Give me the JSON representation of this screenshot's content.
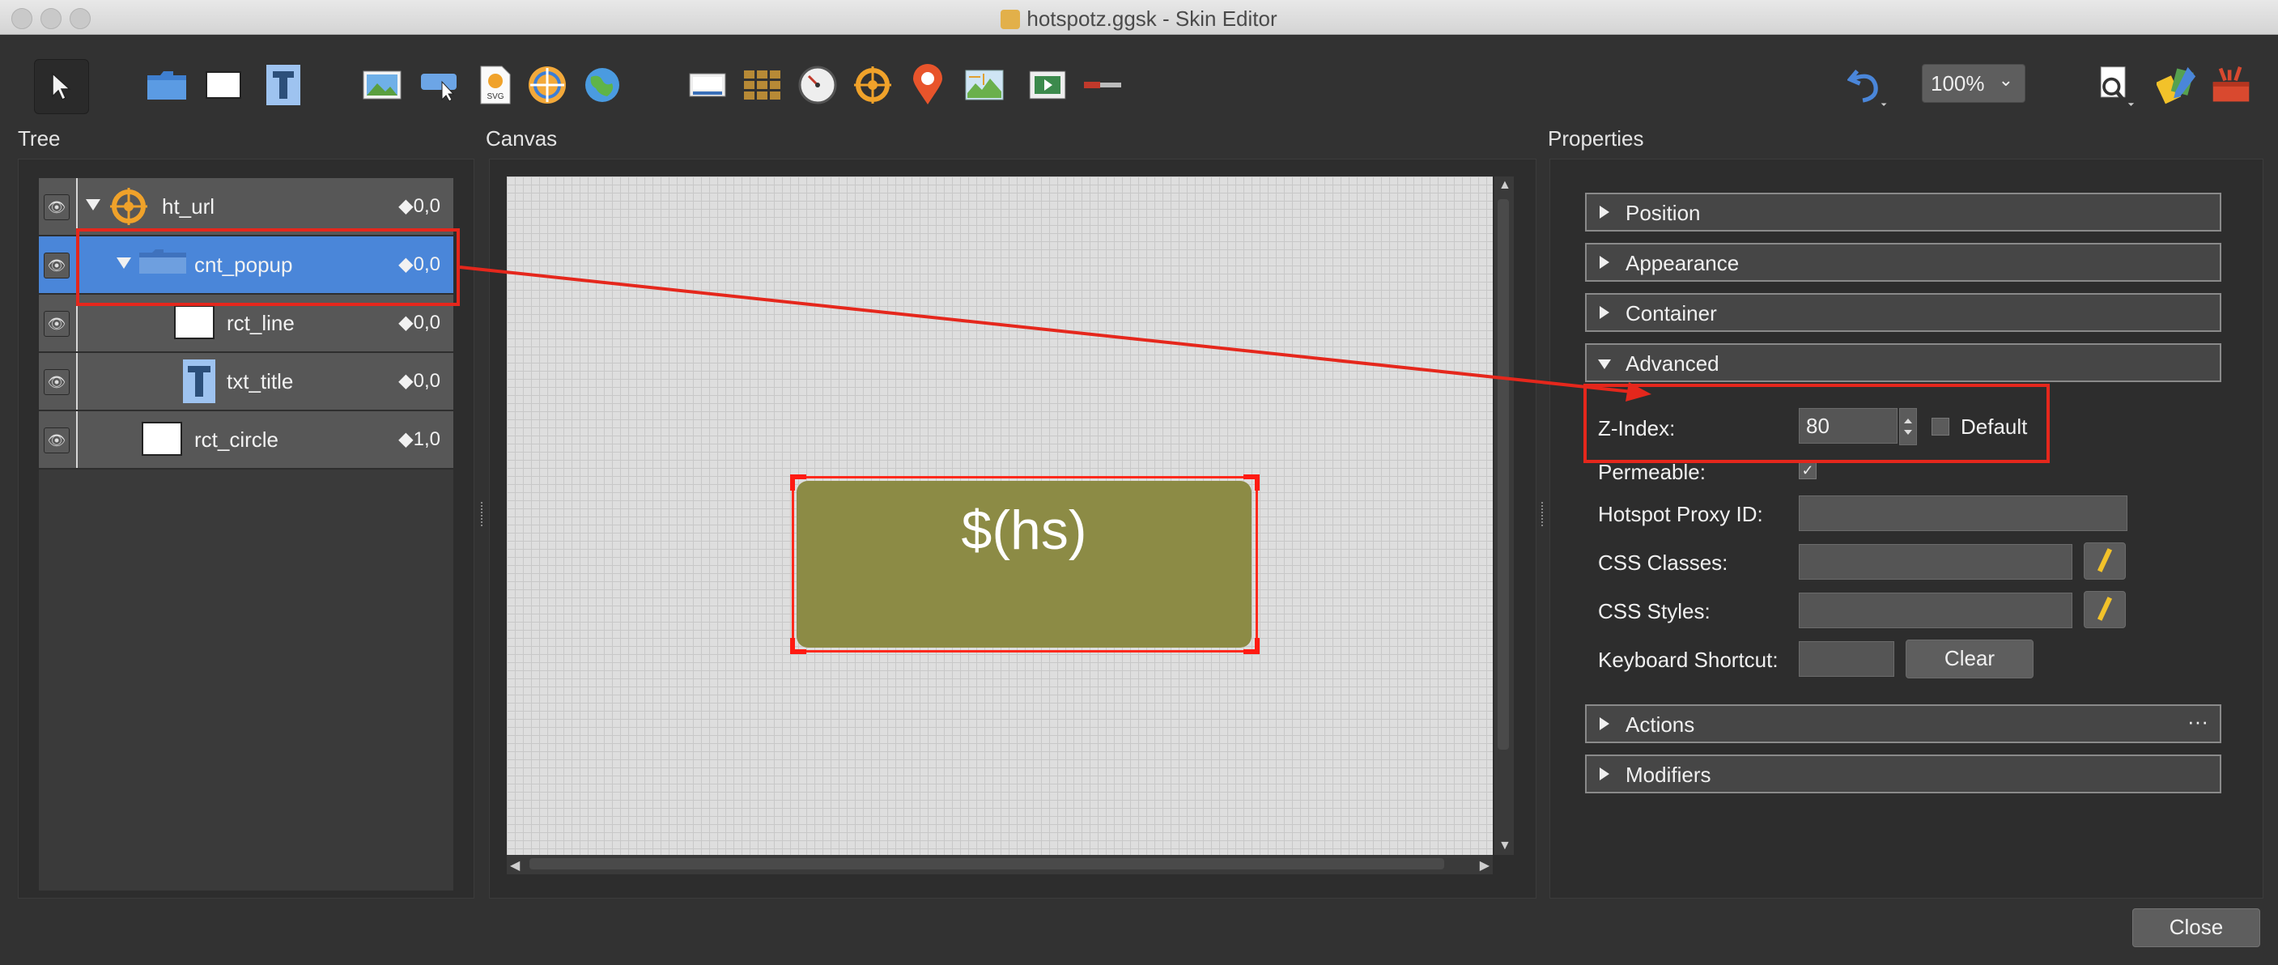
{
  "window": {
    "title": "hotspotz.ggsk - Skin Editor"
  },
  "toolbar": {
    "tools": [
      {
        "name": "select-tool",
        "icon": "arrow-cursor-icon"
      },
      {
        "name": "container-tool",
        "icon": "folder-icon"
      },
      {
        "name": "rectangle-tool",
        "icon": "rectangle-icon"
      },
      {
        "name": "text-tool",
        "icon": "text-icon"
      },
      {
        "name": "image-tool",
        "icon": "image-icon"
      },
      {
        "name": "button-tool",
        "icon": "button-icon"
      },
      {
        "name": "svg-tool",
        "icon": "svg-icon"
      },
      {
        "name": "hotspot-tool",
        "icon": "hotspot-icon"
      },
      {
        "name": "globe-tool",
        "icon": "globe-icon"
      },
      {
        "name": "screen-tool",
        "icon": "screen-icon"
      },
      {
        "name": "cloner-tool",
        "icon": "grid-icon"
      },
      {
        "name": "timer-tool",
        "icon": "timer-icon"
      },
      {
        "name": "hotspot-proxy-tool",
        "icon": "crosshair-icon"
      },
      {
        "name": "map-pin-tool",
        "icon": "map-pin-icon"
      },
      {
        "name": "map-tool",
        "icon": "map-icon"
      },
      {
        "name": "video-tool",
        "icon": "video-icon"
      },
      {
        "name": "scrollbar-tool",
        "icon": "scrollbar-icon"
      }
    ],
    "zoom": "100%",
    "zoom_caret": "⌄"
  },
  "panels": {
    "tree": "Tree",
    "canvas": "Canvas",
    "properties": "Properties"
  },
  "tree": {
    "rows": [
      {
        "label": "ht_url",
        "value": "◆0,0"
      },
      {
        "label": "cnt_popup",
        "value": "◆0,0"
      },
      {
        "label": "rct_line",
        "value": "◆0,0"
      },
      {
        "label": "txt_title",
        "value": "◆0,0"
      },
      {
        "label": "rct_circle",
        "value": "◆1,0"
      }
    ]
  },
  "canvas": {
    "popup_text": "$(hs)"
  },
  "properties": {
    "sections": {
      "position": "Position",
      "appearance": "Appearance",
      "container": "Container",
      "advanced": "Advanced",
      "actions": "Actions",
      "actions_more": "···",
      "modifiers": "Modifiers"
    },
    "zindex_label": "Z-Index:",
    "zindex_value": "80",
    "default_label": "Default",
    "permeable_label": "Permeable:",
    "permeable_check": "✓",
    "proxy_label": "Hotspot Proxy ID:",
    "css_classes_label": "CSS Classes:",
    "css_styles_label": "CSS Styles:",
    "shortcut_label": "Keyboard Shortcut:",
    "clear_label": "Clear"
  },
  "footer": {
    "close_label": "Close"
  },
  "colors": {
    "selection_blue": "#4a86d9",
    "annotation_red": "#e5271c",
    "popup_olive": "#8c8b45"
  }
}
